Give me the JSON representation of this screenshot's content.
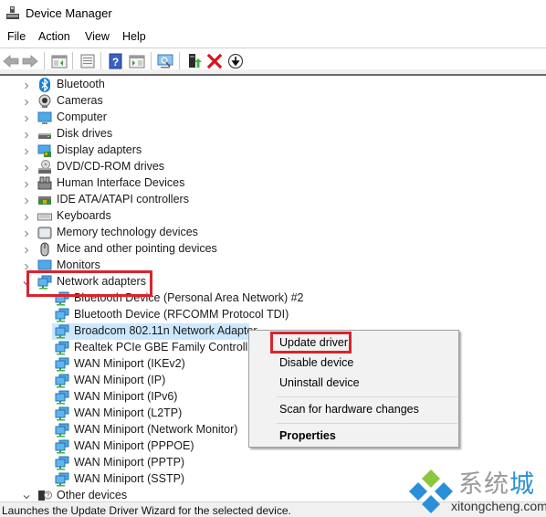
{
  "window": {
    "title": "Device Manager"
  },
  "menubar": {
    "items": [
      "File",
      "Action",
      "View",
      "Help"
    ]
  },
  "toolbar": {
    "buttons": [
      "back-icon",
      "forward-icon",
      "show-hide-console-tree-icon",
      "properties-icon",
      "help-icon",
      "show-hide-action-pane-icon",
      "scan-hardware-icon",
      "update-driver-icon",
      "uninstall-icon",
      "disable-icon"
    ]
  },
  "tree": {
    "categories": [
      {
        "label": "Bluetooth",
        "icon": "bluetooth-icon",
        "expanded": false
      },
      {
        "label": "Cameras",
        "icon": "camera-icon",
        "expanded": false
      },
      {
        "label": "Computer",
        "icon": "computer-icon",
        "expanded": false
      },
      {
        "label": "Disk drives",
        "icon": "disk-drive-icon",
        "expanded": false
      },
      {
        "label": "Display adapters",
        "icon": "display-adapter-icon",
        "expanded": false
      },
      {
        "label": "DVD/CD-ROM drives",
        "icon": "dvd-drive-icon",
        "expanded": false
      },
      {
        "label": "Human Interface Devices",
        "icon": "hid-icon",
        "expanded": false
      },
      {
        "label": "IDE ATA/ATAPI controllers",
        "icon": "ide-controller-icon",
        "expanded": false
      },
      {
        "label": "Keyboards",
        "icon": "keyboard-icon",
        "expanded": false
      },
      {
        "label": "Memory technology devices",
        "icon": "memory-device-icon",
        "expanded": false
      },
      {
        "label": "Mice and other pointing devices",
        "icon": "mouse-icon",
        "expanded": false
      },
      {
        "label": "Monitors",
        "icon": "monitor-icon",
        "expanded": false
      },
      {
        "label": "Network adapters",
        "icon": "network-adapter-icon",
        "expanded": true
      }
    ],
    "network_adapters": [
      "Bluetooth Device (Personal Area Network) #2",
      "Bluetooth Device (RFCOMM Protocol TDI)",
      "Broadcom 802.11n Network Adapter",
      "Realtek PCIe GBE Family Controller",
      "WAN Miniport (IKEv2)",
      "WAN Miniport (IP)",
      "WAN Miniport (IPv6)",
      "WAN Miniport (L2TP)",
      "WAN Miniport (Network Monitor)",
      "WAN Miniport (PPPOE)",
      "WAN Miniport (PPTP)",
      "WAN Miniport (SSTP)"
    ],
    "selected": "Broadcom 802.11n Network Adapter",
    "after": {
      "label": "Other devices",
      "icon": "unknown-device-icon",
      "expanded": true
    }
  },
  "context_menu": {
    "items": [
      {
        "label": "Update driver",
        "highlighted": true
      },
      {
        "label": "Disable device"
      },
      {
        "label": "Uninstall device"
      },
      {
        "label": "Scan for hardware changes"
      },
      {
        "label": "Properties",
        "bold": true
      }
    ]
  },
  "statusbar": {
    "text": "Launches the Update Driver Wizard for the selected device."
  },
  "watermark": {
    "cn_gray": "系统",
    "cn_blue": "城",
    "url": "xitongcheng.com"
  },
  "colors": {
    "highlight_box": "#d9232e",
    "selection": "#cce8ff",
    "watermark_blue": "#2a8fd8",
    "watermark_green": "#8cc63f"
  }
}
